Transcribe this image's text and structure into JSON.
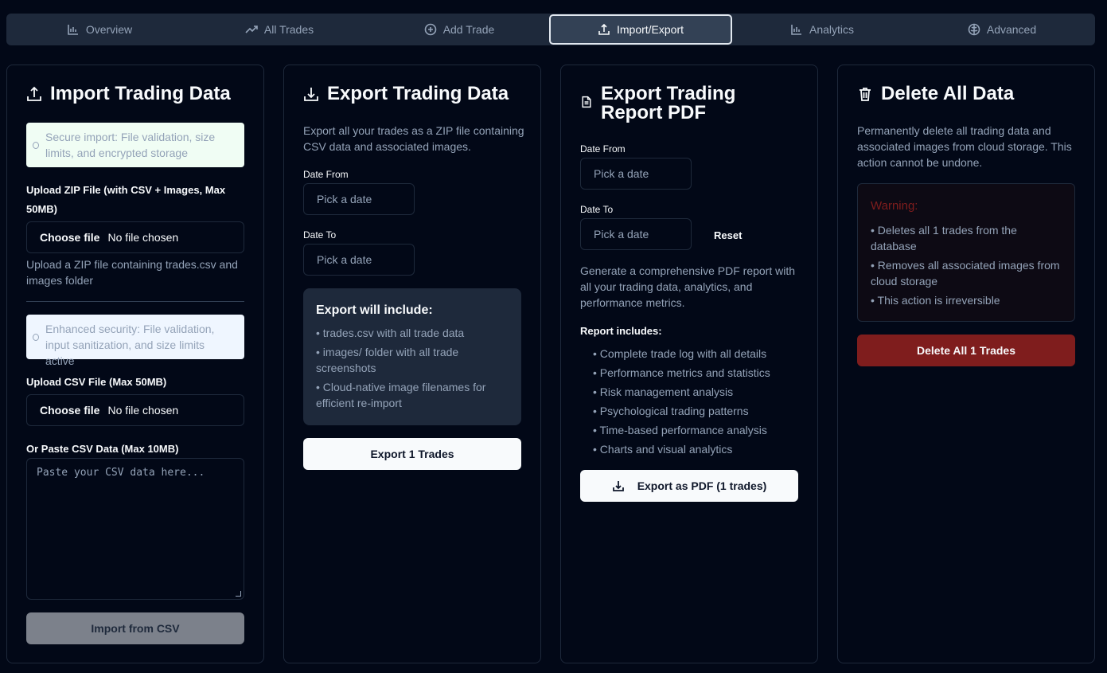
{
  "tabs": [
    {
      "label": "Overview",
      "icon": "bar-chart-icon"
    },
    {
      "label": "All Trades",
      "icon": "trending-up-icon"
    },
    {
      "label": "Add Trade",
      "icon": "plus-circle-icon"
    },
    {
      "label": "Import/Export",
      "icon": "upload-icon"
    },
    {
      "label": "Analytics",
      "icon": "bar-chart-icon"
    },
    {
      "label": "Advanced",
      "icon": "brain-icon"
    }
  ],
  "active_tab": "Import/Export",
  "import": {
    "title": "Import Trading Data",
    "secure_notice": "Secure import: File validation, size limits, and encrypted storage",
    "zip_label": "Upload ZIP File (with CSV + Images, Max 50MB)",
    "zip_choose": "Choose file",
    "zip_status": "No file chosen",
    "zip_help": "Upload a ZIP file containing trades.csv and images folder",
    "security_notice": "Enhanced security: File validation, input sanitization, and size limits active",
    "csv_label": "Upload CSV File (Max 50MB)",
    "csv_choose": "Choose file",
    "csv_status": "No file chosen",
    "paste_label": "Or Paste CSV Data (Max 10MB)",
    "paste_placeholder": "Paste your CSV data here...",
    "import_button": "Import from CSV"
  },
  "export": {
    "title": "Export Trading Data",
    "description": "Export all your trades as a ZIP file containing CSV data and associated images.",
    "date_from_label": "Date From",
    "date_from_placeholder": "Pick a date",
    "date_to_label": "Date To",
    "date_to_placeholder": "Pick a date",
    "include_title": "Export will include:",
    "include_items": [
      "• trades.csv with all trade data",
      "• images/ folder with all trade screenshots",
      "• Cloud-native image filenames for efficient re-import"
    ],
    "export_button": "Export 1 Trades"
  },
  "report": {
    "title": "Export Trading Report PDF",
    "date_from_label": "Date From",
    "date_from_placeholder": "Pick a date",
    "date_to_label": "Date To",
    "date_to_placeholder": "Pick a date",
    "reset_button": "Reset",
    "description": "Generate a comprehensive PDF report with all your trading data, analytics, and performance metrics.",
    "includes_title": "Report includes:",
    "includes_items": [
      "• Complete trade log with all details",
      "• Performance metrics and statistics",
      "• Risk management analysis",
      "• Psychological trading patterns",
      "• Time-based performance analysis",
      "• Charts and visual analytics"
    ],
    "export_button": "Export as PDF (1 trades)"
  },
  "delete": {
    "title": "Delete All Data",
    "description": "Permanently delete all trading data and associated images from cloud storage. This action cannot be undone.",
    "warning_title": "Warning:",
    "warning_items": [
      "• Deletes all 1 trades from the database",
      "• Removes all associated images from cloud storage",
      "• This action is irreversible"
    ],
    "delete_button": "Delete All 1 Trades"
  },
  "colors": {
    "background": "#020817",
    "card_border": "#1e293b",
    "danger": "#7f1d1d",
    "success_bg": "#f0fdf4",
    "info_bg": "#eff6ff"
  }
}
